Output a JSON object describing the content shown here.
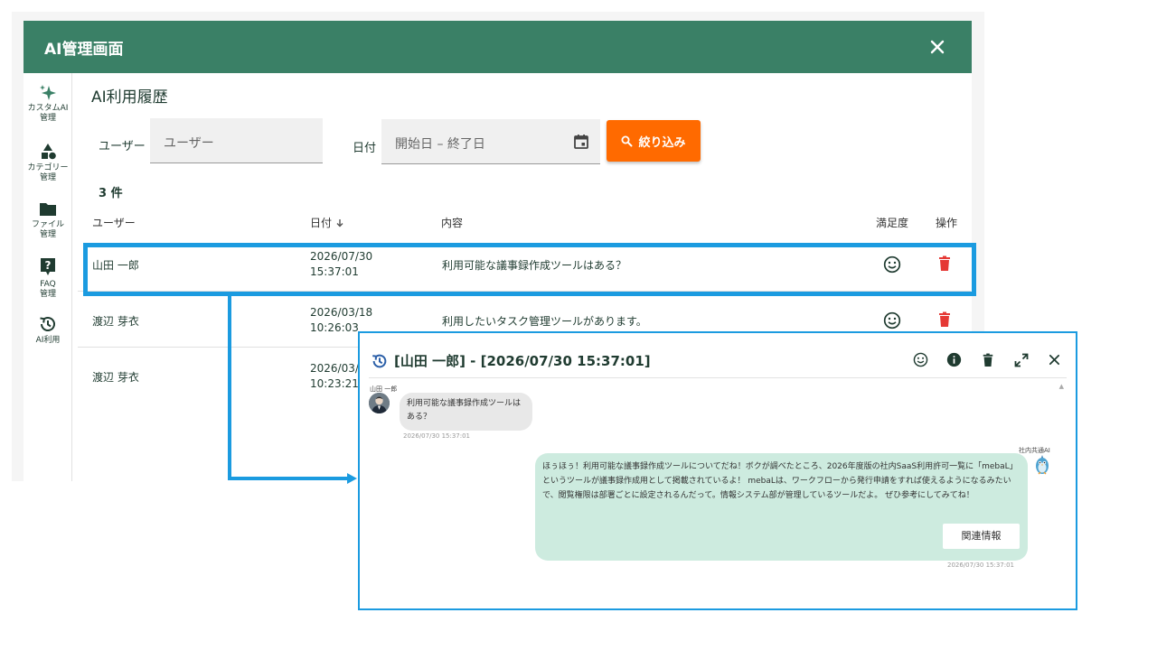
{
  "window": {
    "title": "AI管理画面"
  },
  "nav": [
    {
      "label": "カスタムAI\n管理",
      "icon": "sparkle-icon"
    },
    {
      "label": "カテゴリー\n管理",
      "icon": "shapes-icon"
    },
    {
      "label": "ファイル\n管理",
      "icon": "folder-icon"
    },
    {
      "label": "FAQ\n管理",
      "icon": "faq-icon"
    },
    {
      "label": "AI利用",
      "icon": "history-icon"
    }
  ],
  "page": {
    "title": "AI利用履歴"
  },
  "filters": {
    "user_label": "ユーザー",
    "user_placeholder": "ユーザー",
    "date_label": "日付",
    "date_placeholder": "開始日 – 終了日",
    "submit_label": "絞り込み"
  },
  "results": {
    "count": "3 件"
  },
  "table": {
    "headers": {
      "user": "ユーザー",
      "date": "日付",
      "content": "内容",
      "satisfaction": "満足度",
      "actions": "操作"
    },
    "rows": [
      {
        "user": "山田 一郎",
        "date": "2026/07/30",
        "time": "15:37:01",
        "content": "利用可能な議事録作成ツールはある？"
      },
      {
        "user": "渡辺 芽衣",
        "date": "2026/03/18",
        "time": "10:26:03",
        "content": "利用したいタスク管理ツールがあります。"
      },
      {
        "user": "渡辺 芽衣",
        "date": "2026/03/",
        "time": "10:23:21",
        "content": ""
      }
    ]
  },
  "detail": {
    "title": "[山田 一郎] - [2026/07/30 15:37:01]",
    "user_name": "山田 一郎",
    "user_message": "利用可能な議事録作成ツールはある？",
    "user_timestamp": "2026/07/30 15:37:01",
    "ai_name": "社内共通AI",
    "ai_message": "ほぅほぅ！利用可能な議事録作成ツールについてだね！ボクが調べたところ、2026年度版の社内SaaS利用許可一覧に「mebaL」というツールが議事録作成用として掲載されているよ！ mebaLは、ワークフローから発行申請をすれば使えるようになるみたいで、閲覧権限は部署ごとに設定されるんだって。情報システム部が管理しているツールだよ。 ぜひ参考にしてみてね！",
    "related_button": "関連情報",
    "ai_timestamp": "2026/07/30 15:37:01"
  },
  "colors": {
    "header_bg": "#3a8066",
    "accent_orange": "#ff6a00",
    "highlight_blue": "#1b9be0",
    "delete_red": "#e53935",
    "ai_bubble": "#cdebdf"
  }
}
